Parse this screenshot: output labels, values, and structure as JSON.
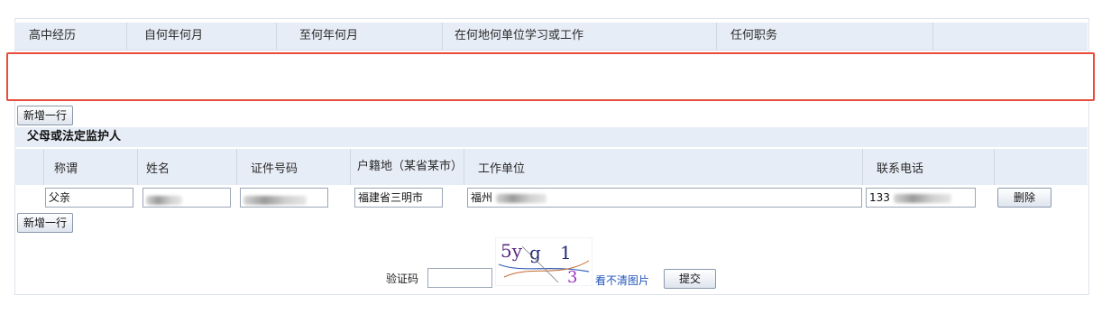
{
  "high_school": {
    "columns": [
      "高中经历",
      "自何年何月",
      "至何年何月",
      "在何地何单位学习或工作",
      "任何职务"
    ]
  },
  "buttons": {
    "add_row_1": "新增一行",
    "add_row_2": "新增一行",
    "delete": "删除",
    "submit": "提交"
  },
  "guardian": {
    "title": "父母或法定监护人",
    "columns": [
      "称谓",
      "姓名",
      "证件号码",
      "户籍地（某省某市）",
      "工作单位",
      "联系电话"
    ],
    "row": {
      "title_value": "父亲",
      "name_value": "",
      "id_value": "",
      "hukou_value": "福建省三明市",
      "work_unit_value": "福州",
      "phone_value": "133"
    }
  },
  "captcha": {
    "label": "验证码",
    "image_text": "5yg 1 3",
    "unclear_link": "看不清图片"
  }
}
